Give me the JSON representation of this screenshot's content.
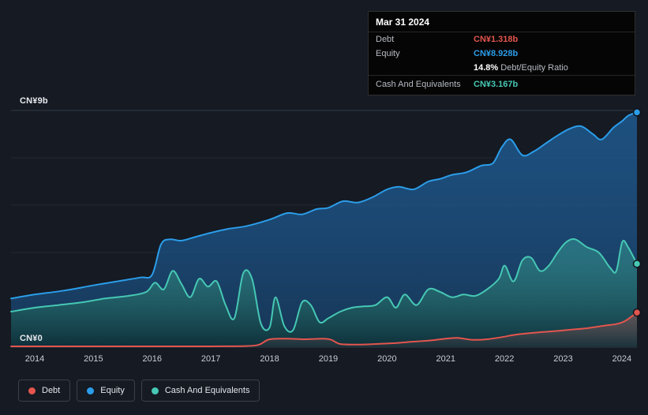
{
  "tooltip": {
    "date": "Mar 31 2024",
    "debt_label": "Debt",
    "debt_value": "CN¥1.318b",
    "equity_label": "Equity",
    "equity_value": "CN¥8.928b",
    "ratio_value": "14.8%",
    "ratio_label": "Debt/Equity Ratio",
    "cash_label": "Cash And Equivalents",
    "cash_value": "CN¥3.167b"
  },
  "axis": {
    "y_max_label": "CN¥9b",
    "y_min_label": "CN¥0",
    "x_ticks": [
      "2014",
      "2015",
      "2016",
      "2017",
      "2018",
      "2019",
      "2020",
      "2021",
      "2022",
      "2023",
      "2024"
    ]
  },
  "legend": [
    {
      "label": "Debt",
      "color": "#e3554e"
    },
    {
      "label": "Equity",
      "color": "#2b9de9"
    },
    {
      "label": "Cash And Equivalents",
      "color": "#46c8b4"
    }
  ],
  "colors": {
    "background": "#151a23",
    "grid_inner": "#232a33",
    "grid_edge": "#343b45",
    "debt": "#e3554e",
    "equity": "#2b9de9",
    "cash": "#46c8b4"
  },
  "chart_data": {
    "type": "area",
    "title": "",
    "xlabel": "",
    "ylabel": "",
    "y_unit": "CN¥ billions",
    "x_range": [
      2013.6,
      2024.25
    ],
    "y_range": [
      0,
      9
    ],
    "grid": true,
    "legend_position": "bottom-left",
    "series": [
      {
        "name": "Debt",
        "color": "#e3554e",
        "x": [
          2013.6,
          2014.5,
          2015.5,
          2016.5,
          2017.0,
          2017.5,
          2017.8,
          2018.0,
          2018.3,
          2018.6,
          2018.9,
          2019.05,
          2019.2,
          2019.5,
          2019.8,
          2020.1,
          2020.4,
          2020.7,
          2021.0,
          2021.2,
          2021.45,
          2021.7,
          2021.95,
          2022.2,
          2022.5,
          2022.8,
          2023.1,
          2023.4,
          2023.7,
          2023.9,
          2024.05,
          2024.25
        ],
        "values": [
          0.03,
          0.03,
          0.03,
          0.03,
          0.03,
          0.04,
          0.08,
          0.3,
          0.32,
          0.3,
          0.32,
          0.28,
          0.12,
          0.1,
          0.12,
          0.15,
          0.2,
          0.25,
          0.32,
          0.35,
          0.28,
          0.3,
          0.38,
          0.48,
          0.55,
          0.6,
          0.66,
          0.72,
          0.82,
          0.88,
          1.0,
          1.318
        ]
      },
      {
        "name": "Equity",
        "color": "#2b9de9",
        "x": [
          2013.6,
          2014.0,
          2014.5,
          2015.0,
          2015.4,
          2015.8,
          2016.0,
          2016.15,
          2016.3,
          2016.5,
          2016.75,
          2017.0,
          2017.3,
          2017.6,
          2018.0,
          2018.3,
          2018.55,
          2018.8,
          2019.0,
          2019.25,
          2019.5,
          2019.75,
          2020.0,
          2020.2,
          2020.45,
          2020.7,
          2020.9,
          2021.1,
          2021.35,
          2021.6,
          2021.8,
          2021.95,
          2022.1,
          2022.3,
          2022.5,
          2022.7,
          2022.9,
          2023.1,
          2023.3,
          2023.5,
          2023.65,
          2023.85,
          2024.0,
          2024.1,
          2024.25
        ],
        "values": [
          1.85,
          2.0,
          2.15,
          2.35,
          2.5,
          2.65,
          2.75,
          3.9,
          4.1,
          4.05,
          4.2,
          4.35,
          4.5,
          4.6,
          4.85,
          5.1,
          5.05,
          5.25,
          5.3,
          5.55,
          5.5,
          5.7,
          6.0,
          6.1,
          6.0,
          6.3,
          6.4,
          6.55,
          6.65,
          6.9,
          7.0,
          7.6,
          7.9,
          7.3,
          7.45,
          7.75,
          8.05,
          8.3,
          8.4,
          8.1,
          7.9,
          8.35,
          8.6,
          8.8,
          8.928
        ]
      },
      {
        "name": "Cash And Equivalents",
        "color": "#46c8b4",
        "x": [
          2013.6,
          2014.0,
          2014.4,
          2014.8,
          2015.2,
          2015.6,
          2015.9,
          2016.05,
          2016.2,
          2016.35,
          2016.5,
          2016.65,
          2016.8,
          2016.95,
          2017.1,
          2017.25,
          2017.4,
          2017.55,
          2017.7,
          2017.85,
          2018.0,
          2018.1,
          2018.25,
          2018.4,
          2018.55,
          2018.7,
          2018.85,
          2019.0,
          2019.2,
          2019.4,
          2019.6,
          2019.8,
          2020.0,
          2020.15,
          2020.3,
          2020.5,
          2020.7,
          2020.9,
          2021.1,
          2021.3,
          2021.5,
          2021.7,
          2021.9,
          2022.0,
          2022.15,
          2022.3,
          2022.45,
          2022.6,
          2022.75,
          2022.9,
          2023.05,
          2023.2,
          2023.4,
          2023.6,
          2023.8,
          2023.9,
          2024.0,
          2024.1,
          2024.25
        ],
        "values": [
          1.35,
          1.5,
          1.6,
          1.7,
          1.85,
          1.95,
          2.1,
          2.45,
          2.2,
          2.9,
          2.4,
          1.9,
          2.6,
          2.3,
          2.5,
          1.6,
          1.1,
          2.8,
          2.6,
          0.9,
          0.75,
          1.9,
          0.8,
          0.65,
          1.7,
          1.6,
          0.95,
          1.1,
          1.35,
          1.5,
          1.55,
          1.6,
          1.9,
          1.5,
          2.0,
          1.6,
          2.2,
          2.1,
          1.9,
          2.0,
          1.95,
          2.2,
          2.6,
          3.1,
          2.5,
          3.3,
          3.4,
          2.9,
          3.1,
          3.6,
          4.0,
          4.1,
          3.8,
          3.6,
          3.0,
          2.9,
          4.0,
          3.8,
          3.167
        ]
      }
    ]
  }
}
